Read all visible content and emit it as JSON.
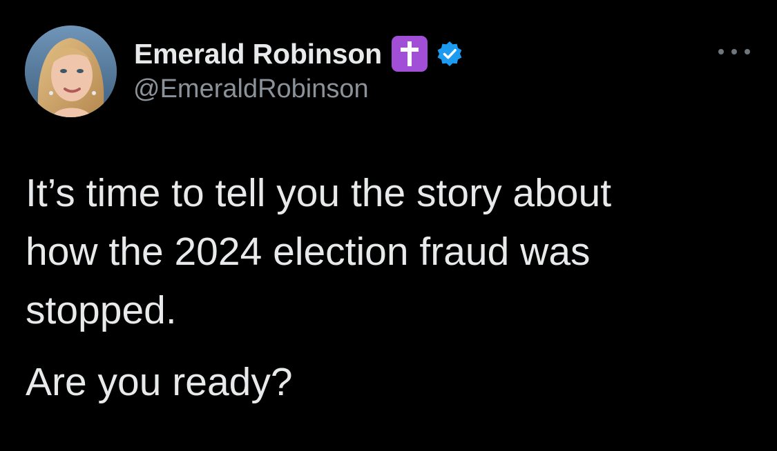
{
  "author": {
    "display_name": "Emerald Robinson",
    "handle": "@EmeraldRobinson",
    "emoji": "latin-cross-emoji",
    "verified": true,
    "verified_color": "#1d9bf0",
    "emoji_bg_color": "#a04fd6"
  },
  "tweet": {
    "lines": [
      "It’s time to tell you the story about",
      "how the 2024 election fraud was",
      "stopped."
    ],
    "second_paragraph": "Are you ready?"
  },
  "colors": {
    "background": "#000000",
    "primary_text": "#e7e9ea",
    "secondary_text": "#8b9299"
  },
  "icons": {
    "more": "more-options-icon",
    "avatar": "profile-avatar"
  }
}
